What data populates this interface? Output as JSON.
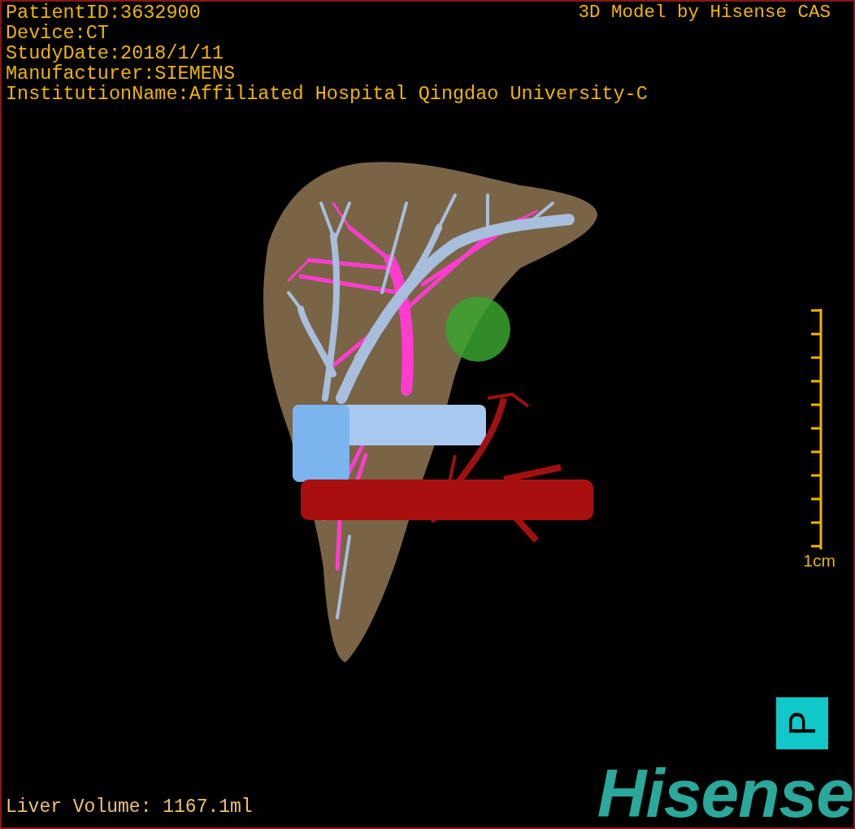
{
  "info_lines": [
    "PatientID:3632900",
    "Device:CT",
    "StudyDate:2018/1/11",
    "Manufacturer:SIEMENS",
    "InstitutionName:Affiliated Hospital Qingdao University-C"
  ],
  "title": "3D Model by Hisense CAS",
  "scale_bar": {
    "label": "1cm"
  },
  "orientation_marker": {
    "label": "P"
  },
  "logo": "Hisense",
  "liver_volume": "Liver Volume: 1167.1ml"
}
